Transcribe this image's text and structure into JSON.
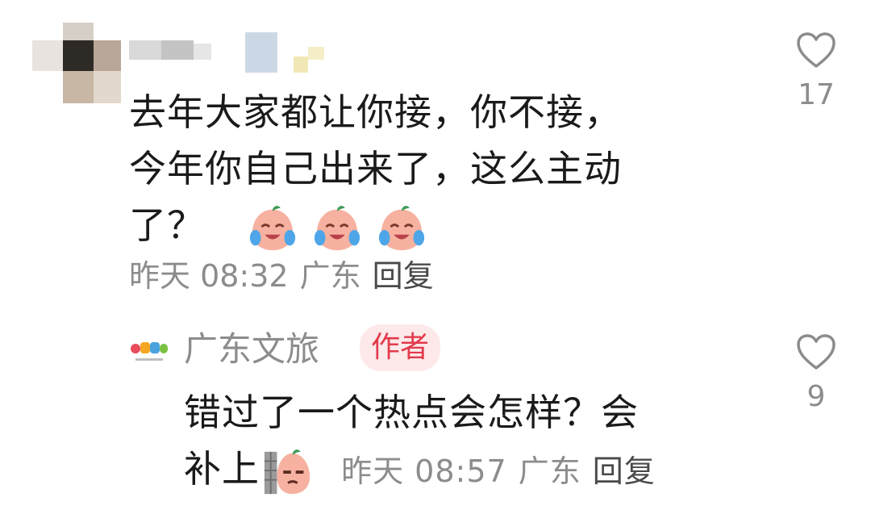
{
  "comments": [
    {
      "text_line1": "去年大家都让你接，你不接，",
      "text_line2": "今年你自己出来了，这么主动",
      "text_line3": "了？",
      "time": "昨天 08:32",
      "location": "广东",
      "reply_label": "回复",
      "likes": "17",
      "emoji": "crying-laughing-peach-emoji"
    },
    {
      "author": "广东文旅",
      "badge": "作者",
      "text_line1": "错过了一个热点会怎样？会",
      "text_line2": "补上",
      "time": "昨天 08:57",
      "location": "广东",
      "reply_label": "回复",
      "likes": "9",
      "emoji": "peeking-peach-emoji"
    }
  ],
  "colors": {
    "text": "#1a1a1a",
    "meta": "#8c8c8c",
    "badge_bg": "#fde8ea",
    "badge_text": "#e23b4c"
  }
}
